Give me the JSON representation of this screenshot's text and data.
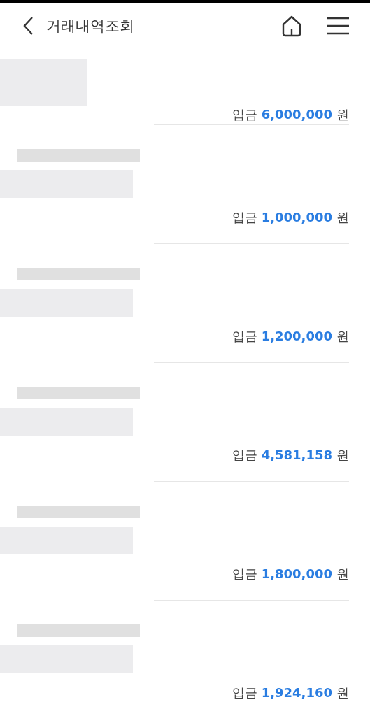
{
  "header": {
    "title": "거래내역조회"
  },
  "transactions": [
    {
      "type": "입금",
      "amount": "6,000,000",
      "unit": "원"
    },
    {
      "type": "입금",
      "amount": "1,000,000",
      "unit": "원"
    },
    {
      "type": "입금",
      "amount": "1,200,000",
      "unit": "원"
    },
    {
      "type": "입금",
      "amount": "4,581,158",
      "unit": "원"
    },
    {
      "type": "입금",
      "amount": "1,800,000",
      "unit": "원"
    },
    {
      "type": "입금",
      "amount": "1,924,160",
      "unit": "원"
    }
  ]
}
